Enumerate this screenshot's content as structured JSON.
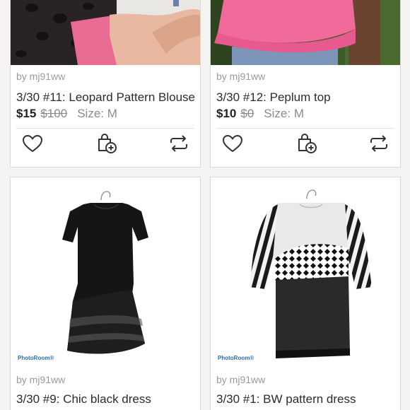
{
  "listings": [
    {
      "seller": "by mj91ww",
      "title": "3/30 #11: Leopard Pattern Blouse",
      "price": "$15",
      "original_price": "$100",
      "size": "Size: M",
      "icons": [
        "heart-icon",
        "bundle-add-icon",
        "share-icon"
      ]
    },
    {
      "seller": "by mj91ww",
      "title": "3/30 #12: Peplum top",
      "price": "$10",
      "original_price": "$0",
      "size": "Size: M",
      "icons": [
        "heart-icon",
        "bundle-add-icon",
        "share-icon"
      ]
    },
    {
      "seller": "by mj91ww",
      "title": "3/30 #9: Chic black dress",
      "watermark": "PhotoRoom®"
    },
    {
      "seller": "by mj91ww",
      "title": "3/30 #1: BW pattern dress",
      "watermark": "PhotoRoom®"
    }
  ],
  "colors": {
    "page_bg": "#f4f3f1",
    "card_border": "#d8d8d8",
    "text": "#2c2c2c",
    "muted": "#9a9a9a",
    "watermark": "#2b6fb0"
  }
}
